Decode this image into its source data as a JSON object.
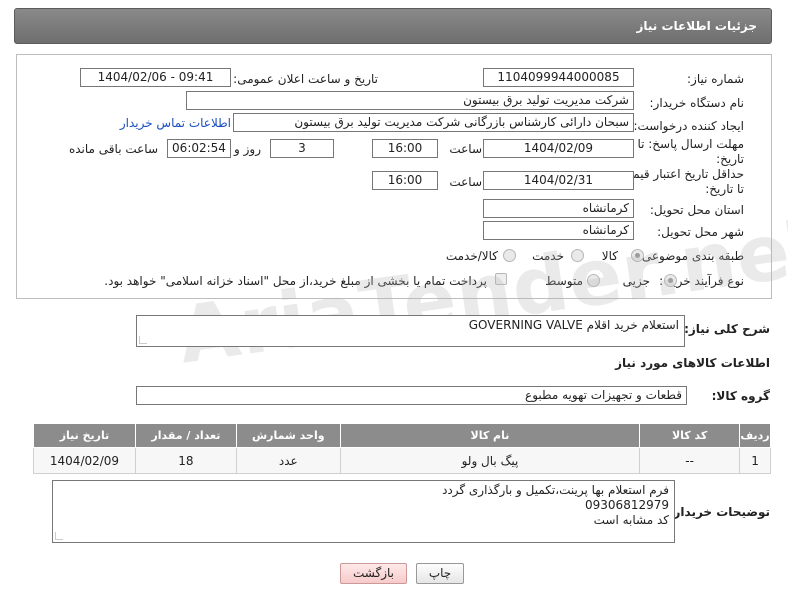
{
  "header": {
    "title": "جزئیات اطلاعات نیاز"
  },
  "form": {
    "need_number": {
      "label": "شماره نیاز:",
      "value": "1104099944000085"
    },
    "announce": {
      "label": "تاریخ و ساعت اعلان عمومی:",
      "value": "1404/02/06 - 09:41"
    },
    "buyer_org": {
      "label": "نام دستگاه خریدار:",
      "value": "شرکت مدیریت تولید برق بیستون"
    },
    "creator": {
      "label": "ایجاد کننده درخواست:",
      "value": "سبحان دارائی کارشناس بازرگانی شرکت مدیریت تولید برق بیستون",
      "contact_link": "اطلاعات تماس خریدار"
    },
    "deadline": {
      "label_line1": "مهلت ارسال پاسخ: تا",
      "label_line2": "تاریخ:",
      "date": "1404/02/09",
      "time_label": "ساعت",
      "time": "16:00",
      "days": "3",
      "days_label": "روز و",
      "remaining": "06:02:54",
      "remaining_label": "ساعت باقی مانده"
    },
    "price_validity": {
      "label_line1": "حداقل تاریخ اعتبار قیمت:",
      "label_line2": "تا تاریخ:",
      "date": "1404/02/31",
      "time_label": "ساعت",
      "time": "16:00"
    },
    "province": {
      "label": "استان محل تحویل:",
      "value": "کرمانشاه"
    },
    "city": {
      "label": "شهر محل تحویل:",
      "value": "کرمانشاه"
    },
    "category": {
      "label": "طبقه بندی موضوعی:",
      "options": [
        "کالا",
        "خدمت",
        "کالا/خدمت"
      ],
      "selected": "کالا"
    },
    "process": {
      "label": "نوع فرآیند خرید :",
      "options": [
        "جزیی",
        "متوسط"
      ],
      "selected": "جزیی",
      "payment_note": "پرداخت تمام یا بخشی از مبلغ خرید،از محل \"اسناد خزانه اسلامی\" خواهد بود."
    }
  },
  "watermark": "AriaTender.neT",
  "summary": {
    "label": "شرح کلی نیاز:",
    "value": "استعلام خرید اقلام GOVERNING VALVE"
  },
  "items_section": {
    "title": "اطلاعات کالاهای مورد نیاز"
  },
  "goods_group": {
    "label": "گروه کالا:",
    "value": "قطعات و تجهیزات تهویه مطبوع"
  },
  "table": {
    "headers": [
      "ردیف",
      "کد کالا",
      "نام کالا",
      "واحد شمارش",
      "تعداد / مقدار",
      "تاریخ نیاز"
    ],
    "rows": [
      [
        "1",
        "--",
        "پیگ بال ولو",
        "عدد",
        "18",
        "1404/02/09"
      ]
    ]
  },
  "buyer_notes": {
    "label": "توضیحات خریدار:",
    "lines": [
      "فرم استعلام بها پرینت،تکمیل و بارگذاری گردد",
      "09306812979",
      "کد مشابه است"
    ]
  },
  "buttons": {
    "print": "چاپ",
    "back": "بازگشت"
  }
}
